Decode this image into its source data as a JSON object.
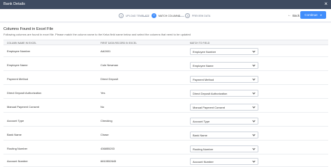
{
  "window": {
    "title": "Bank Details",
    "close_glyph": "×"
  },
  "steps": [
    {
      "number": "1",
      "label": "UPLOAD TEMPLATE",
      "state": "done"
    },
    {
      "number": "2",
      "label": "MATCH COLUMNS",
      "state": "active"
    },
    {
      "number": "3",
      "label": "PREVIEW DATA",
      "state": "pending"
    }
  ],
  "actions": {
    "back_label": "Back",
    "continue_label": "Continue"
  },
  "section": {
    "title": "Columns Found in Excel File",
    "subtitle": "Following columns are found in excel file. Please match the column name to the Keka field name below and select the columns that need to be updated"
  },
  "table": {
    "headers": [
      "COLUMN NAME IN EXCEL",
      "FIRST DATA RECORD IN EXCEL",
      "MATCH TO FIELD"
    ],
    "rows": [
      {
        "column": "Employee Number",
        "first_record": "AA2401",
        "match": "Employee Number"
      },
      {
        "column": "Employee Name",
        "first_record": "Cole Newman",
        "match": "Employee Name"
      },
      {
        "column": "Payment Method",
        "first_record": "Direct Deposit",
        "match": "Payment Method"
      },
      {
        "column": "Direct Deposit Authorization",
        "first_record": "Yes",
        "match": "Direct Deposit Authorization"
      },
      {
        "column": "Manual Payment Consent",
        "first_record": "No",
        "match": "Manual Payment Consent"
      },
      {
        "column": "Account Type",
        "first_record": "Checking",
        "match": "Account Type"
      },
      {
        "column": "Bank Name",
        "first_record": "Chase",
        "match": "Bank Name"
      },
      {
        "column": "Routing Number",
        "first_record": "436855203",
        "match": "Routing Number"
      },
      {
        "column": "Account Number",
        "first_record": "6810552645",
        "match": "Account Number"
      }
    ]
  },
  "colors": {
    "topbar": "#3e4b61",
    "accent": "#408dfb"
  }
}
